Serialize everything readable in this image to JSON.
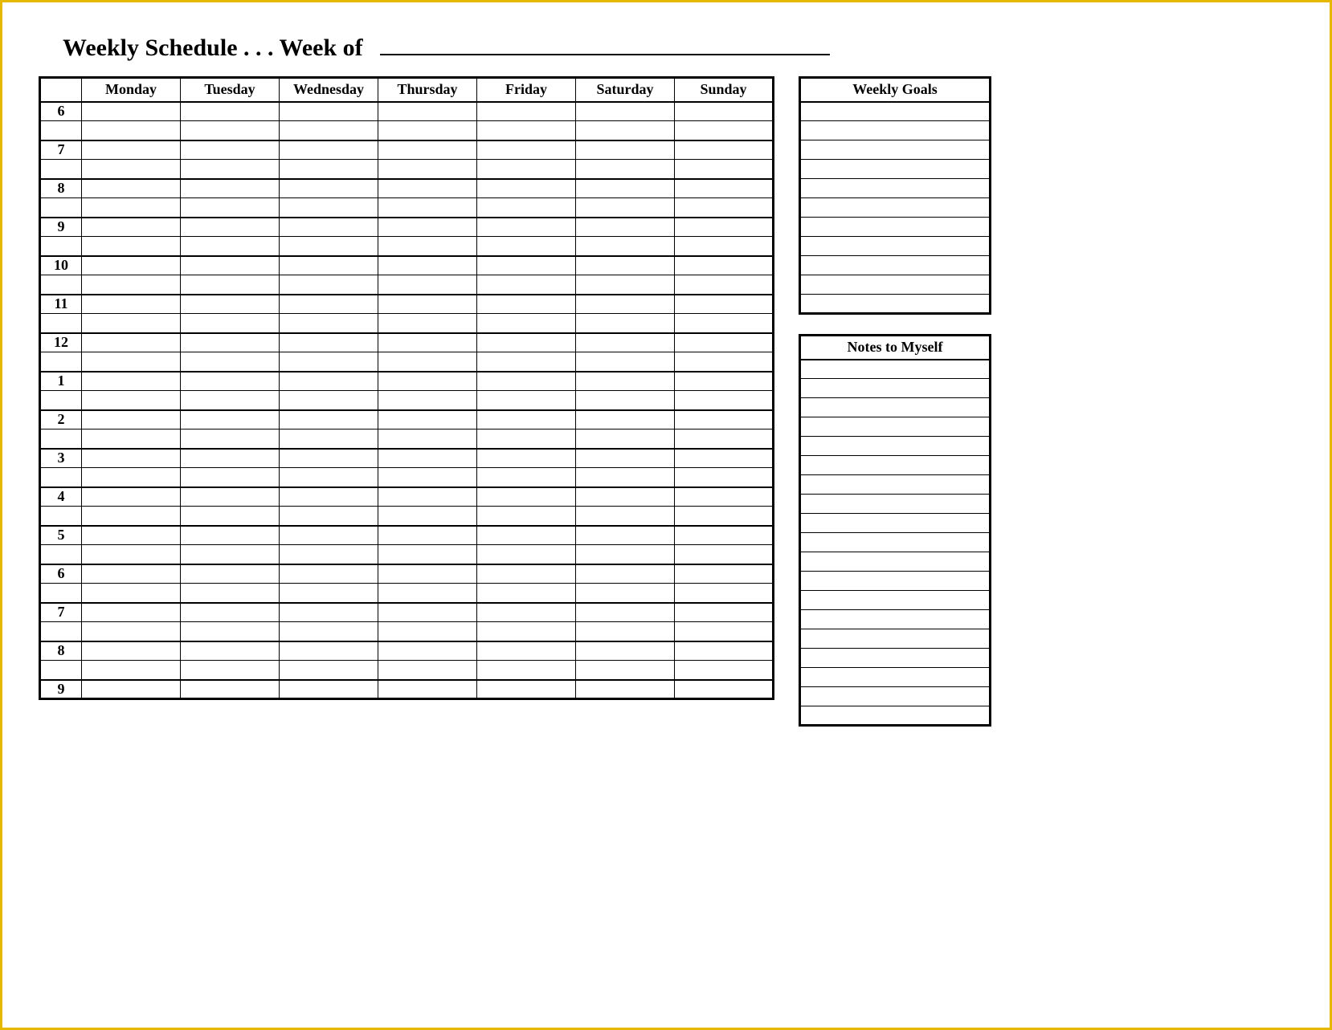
{
  "title": "Weekly Schedule . . . Week of  ",
  "days": [
    "Monday",
    "Tuesday",
    "Wednesday",
    "Thursday",
    "Friday",
    "Saturday",
    "Sunday"
  ],
  "hours": [
    "6",
    "7",
    "8",
    "9",
    "10",
    "11",
    "12",
    "1",
    "2",
    "3",
    "4",
    "5",
    "6",
    "7",
    "8",
    "9"
  ],
  "sidebar": {
    "goals_title": "Weekly Goals",
    "goals_lines": 11,
    "notes_title": "Notes to Myself",
    "notes_lines": 19
  }
}
